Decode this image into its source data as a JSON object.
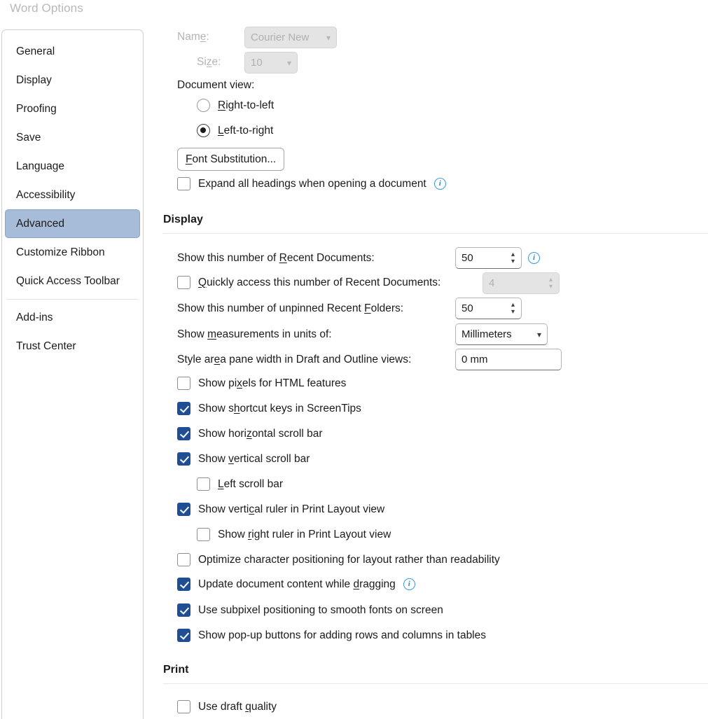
{
  "dialog": {
    "title": "Word Options"
  },
  "sidebar": {
    "items": [
      {
        "label": "General",
        "selected": false
      },
      {
        "label": "Display",
        "selected": false
      },
      {
        "label": "Proofing",
        "selected": false
      },
      {
        "label": "Save",
        "selected": false
      },
      {
        "label": "Language",
        "selected": false
      },
      {
        "label": "Accessibility",
        "selected": false
      },
      {
        "label": "Advanced",
        "selected": true
      },
      {
        "label": "Customize Ribbon",
        "selected": false
      },
      {
        "label": "Quick Access Toolbar",
        "selected": false
      },
      {
        "label": "Add-ins",
        "selected": false
      },
      {
        "label": "Trust Center",
        "selected": false
      }
    ]
  },
  "font_group": {
    "name_label": "Name:",
    "name_value": "Courier New",
    "size_label": "Size:",
    "size_value": "10"
  },
  "document_view": {
    "label": "Document view:",
    "options": [
      {
        "label": "Right-to-left",
        "selected": false
      },
      {
        "label": "Left-to-right",
        "selected": true
      }
    ]
  },
  "font_substitution_button": "Font Substitution...",
  "expand_headings": {
    "label": "Expand all headings when opening a document",
    "checked": false,
    "info": "i"
  },
  "display_section": {
    "heading": "Display",
    "recent_documents": {
      "label": "Show this number of Recent Documents:",
      "value": "50",
      "info": "i"
    },
    "quick_access_recent": {
      "label": "Quickly access this number of Recent Documents:",
      "checked": false,
      "value": "4",
      "disabled": true
    },
    "recent_folders": {
      "label": "Show this number of unpinned Recent Folders:",
      "value": "50"
    },
    "measurement_units": {
      "label": "Show measurements in units of:",
      "value": "Millimeters"
    },
    "style_area_pane": {
      "label": "Style area pane width in Draft and Outline views:",
      "value": "0 mm"
    },
    "checkboxes": [
      {
        "label": "Show pixels for HTML features",
        "checked": false,
        "indent": 0
      },
      {
        "label": "Show shortcut keys in ScreenTips",
        "checked": true,
        "indent": 0
      },
      {
        "label": "Show horizontal scroll bar",
        "checked": true,
        "indent": 0
      },
      {
        "label": "Show vertical scroll bar",
        "checked": true,
        "indent": 0
      },
      {
        "label": "Left scroll bar",
        "checked": false,
        "indent": 1
      },
      {
        "label": "Show vertical ruler in Print Layout view",
        "checked": true,
        "indent": 0
      },
      {
        "label": "Show right ruler in Print Layout view",
        "checked": false,
        "indent": 1
      },
      {
        "label": "Optimize character positioning for layout rather than readability",
        "checked": false,
        "indent": 0
      },
      {
        "label": "Update document content while dragging",
        "checked": true,
        "indent": 0,
        "info": "i"
      },
      {
        "label": "Use subpixel positioning to smooth fonts on screen",
        "checked": true,
        "indent": 0
      },
      {
        "label": "Show pop-up buttons for adding rows and columns in tables",
        "checked": true,
        "indent": 0
      }
    ]
  },
  "print_section": {
    "heading": "Print",
    "checkboxes": [
      {
        "label": "Use draft quality",
        "checked": false,
        "indent": 0
      }
    ]
  },
  "colors": {
    "accent_selected": "#a7bcd8",
    "checkbox_checked": "#1f4e95",
    "info_icon": "#2e86c4",
    "title_text": "#b9b9b9"
  }
}
